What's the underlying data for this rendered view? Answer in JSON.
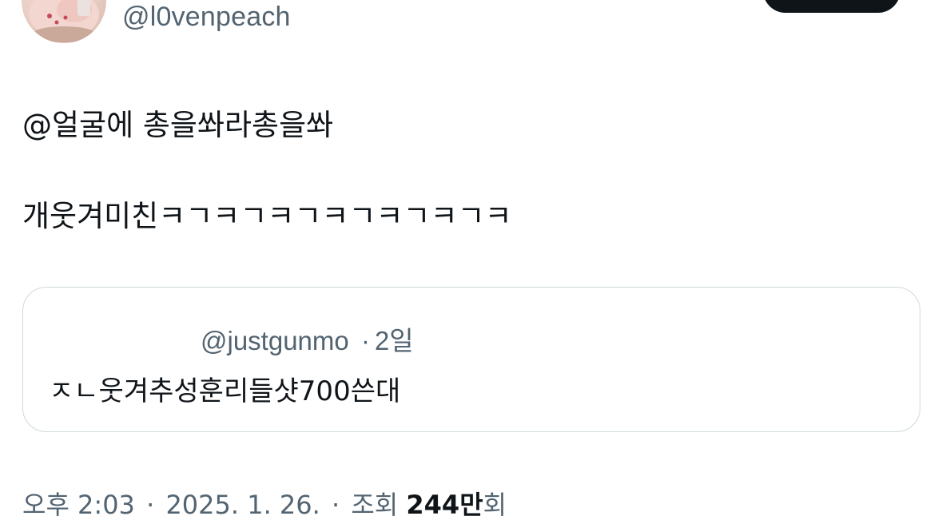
{
  "author": {
    "handle": "@l0venpeach"
  },
  "tweet": {
    "line1": "@얼굴에 총을쏴라총을쏴",
    "line2": "개웃겨미친ㅋㄱㅋㄱㅋㄱㅋㄱㅋㄱㅋㄱㅋ"
  },
  "quote": {
    "handle": "@justgunmo",
    "separator": "·",
    "age": "2일",
    "text": "ㅈㄴ웃겨추성훈리들샷700쓴대"
  },
  "meta": {
    "time": "오후 2:03",
    "date": "2025. 1. 26.",
    "views_label": "조회",
    "views_count": "244만",
    "views_suffix": "회",
    "separator": "·"
  },
  "colors": {
    "text_primary": "#0f1419",
    "text_secondary": "#536471",
    "border": "#cfd9de",
    "button": "#0f1419"
  },
  "icons": {
    "avatar": "pig-plush-avatar"
  }
}
